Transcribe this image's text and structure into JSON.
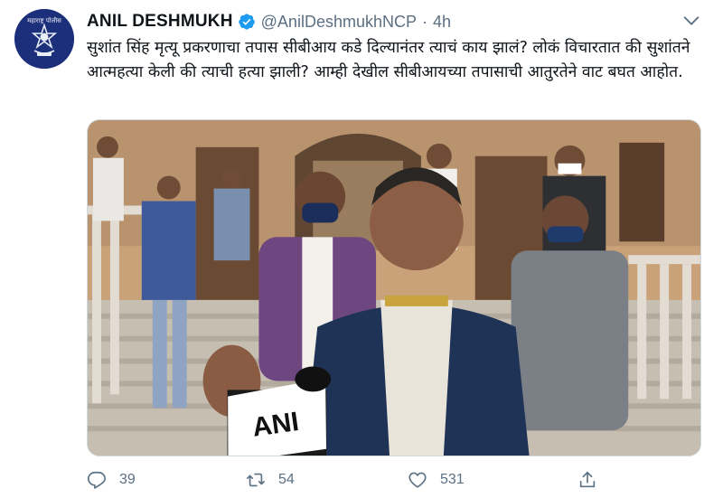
{
  "tweet": {
    "author_name": "ANIL DESHMUKH",
    "handle": "@AnilDeshmukhNCP",
    "separator": "·",
    "time": "4h",
    "text": "सुशांत सिंह मृत्यू प्रकरणाचा तपास सीबीआय कडे दिल्यानंतर त्याचं काय झालं? लोकं विचारतात की सुशांतने आत्महत्या केली की त्याची हत्या झाली? आम्ही देखील सीबीआयच्या तपासाची आतुरतेने वाट बघत आहोत.",
    "avatar_icon": "police-emblem-icon",
    "verified_icon": "verified-badge-icon",
    "menu_icon": "chevron-down-icon"
  },
  "media": {
    "microphone_label": "ANI",
    "avatar_text": "महाराष्ट्र पोलीस"
  },
  "actions": {
    "reply": {
      "icon": "reply-icon",
      "count": "39"
    },
    "retweet": {
      "icon": "retweet-icon",
      "count": "54"
    },
    "like": {
      "icon": "heart-icon",
      "count": "531"
    },
    "share": {
      "icon": "share-icon"
    }
  },
  "colors": {
    "text": "#0f1419",
    "secondary": "#5b7083",
    "verified": "#1d9bf0",
    "avatar_bg": "#1c2f7a"
  }
}
